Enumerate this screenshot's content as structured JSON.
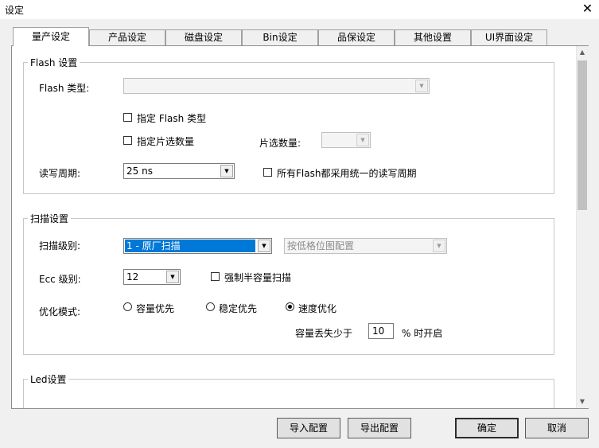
{
  "window": {
    "title": "设定",
    "close_glyph": "✕"
  },
  "tabs": [
    {
      "label": "量产设定",
      "active": true
    },
    {
      "label": "产品设定"
    },
    {
      "label": "磁盘设定"
    },
    {
      "label": "Bin设定"
    },
    {
      "label": "品保设定"
    },
    {
      "label": "其他设置"
    },
    {
      "label": "UI界面设定"
    }
  ],
  "flash_group": {
    "title": "Flash 设置",
    "type_label": "Flash 类型:",
    "type_value": "",
    "specify_type_label": "指定 Flash 类型",
    "specify_cs_label": "指定片选数量",
    "cs_count_label": "片选数量:",
    "cs_count_value": "",
    "rw_period_label": "读写周期:",
    "rw_period_value": "25 ns",
    "uniform_period_label": "所有Flash都采用统一的读写周期"
  },
  "scan_group": {
    "title": "扫描设置",
    "scan_level_label": "扫描级别:",
    "scan_level_value": "1 - 原厂扫描",
    "bitmap_config_value": "按低格位图配置",
    "ecc_label": "Ecc 级别:",
    "ecc_value": "12",
    "force_half_scan_label": "强制半容量扫描",
    "opt_mode_label": "优化模式:",
    "opt_capacity_label": "容量优先",
    "opt_stability_label": "稳定优先",
    "opt_speed_label": "速度优化",
    "opt_selected": "速度优化",
    "capacity_loss_label": "容量丢失少于",
    "capacity_loss_value": "10",
    "capacity_loss_suffix": "% 时开启"
  },
  "led_group": {
    "title": "Led设置"
  },
  "buttons": {
    "import_label": "导入配置",
    "export_label": "导出配置",
    "ok_label": "确定",
    "cancel_label": "取消"
  },
  "icons": {
    "dropdown": "chevron-down-icon",
    "scroll_up": "scroll-up-icon",
    "scroll_down": "scroll-down-icon"
  }
}
